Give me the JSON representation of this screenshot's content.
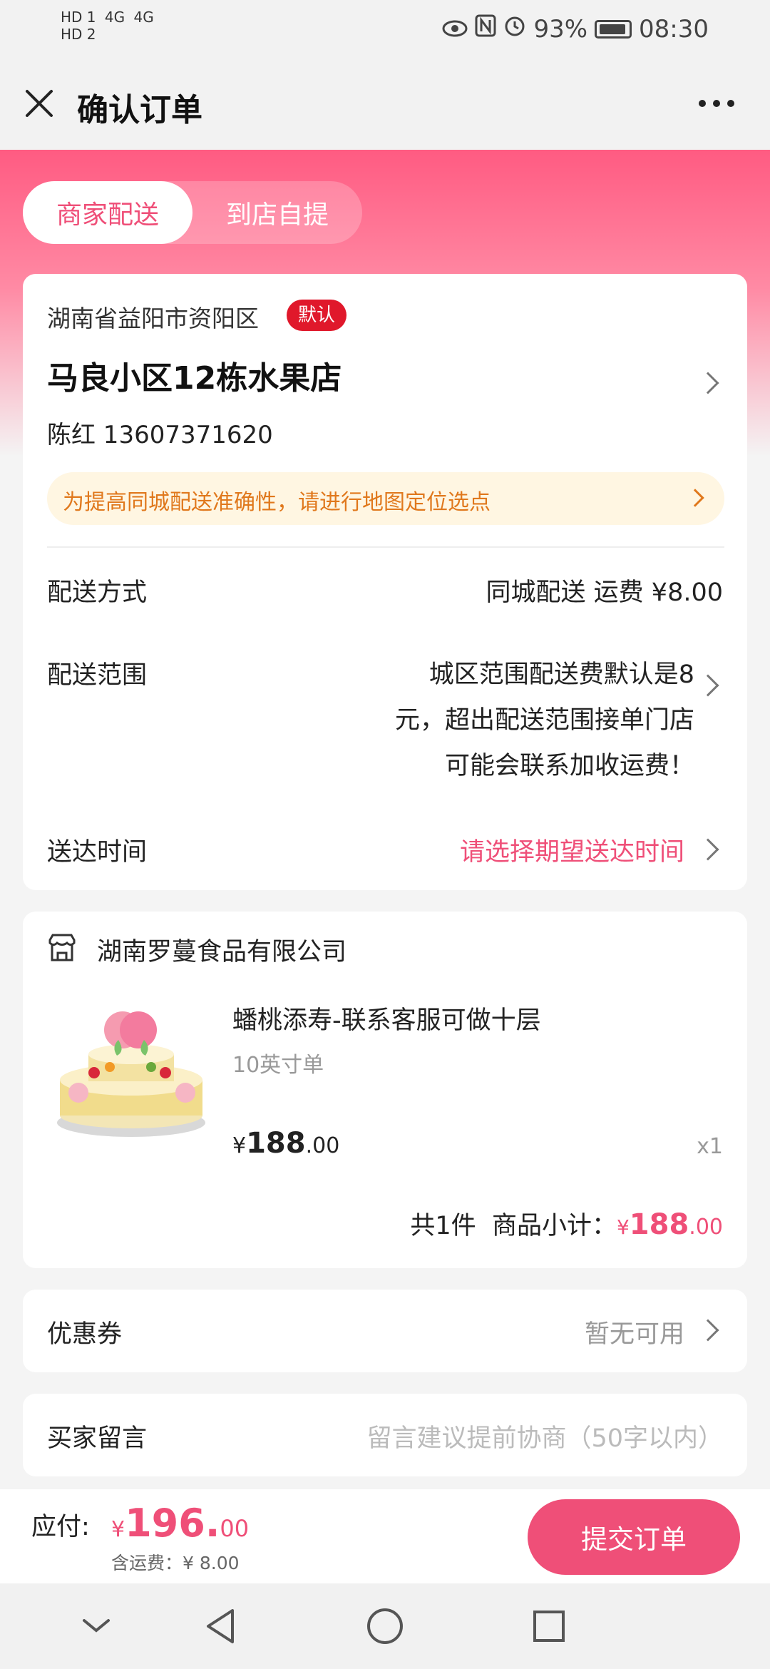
{
  "status_bar": {
    "hd1": "HD 1",
    "hd2": "HD 2",
    "signal1": "4G",
    "signal2": "4G",
    "battery": "93%",
    "time": "08:30"
  },
  "header": {
    "title": "确认订单"
  },
  "delivery_tabs": [
    {
      "label": "商家配送",
      "selected": true
    },
    {
      "label": "到店自提",
      "selected": false
    }
  ],
  "address": {
    "region": "湖南省益阳市资阳区",
    "default_badge": "默认",
    "name": "马良小区12栋水果店",
    "contact": "陈红 13607371620",
    "notice": "为提高同城配送准确性，请进行地图定位选点"
  },
  "delivery": {
    "method_label": "配送方式",
    "method_value": "同城配送 运费 ¥8.00",
    "range_label": "配送范围",
    "range_value": "城区范围配送费默认是8元，超出配送范围接单门店可能会联系加收运费！",
    "time_label": "送达时间",
    "time_value": "请选择期望送达时间"
  },
  "shop": {
    "name": "湖南罗蔓食品有限公司",
    "product": {
      "name": "蟠桃添寿-联系客服可做十层",
      "spec": "10英寸单",
      "price_currency": "¥",
      "price_int": "188",
      "price_dec": ".00",
      "qty": "x1"
    },
    "subtotal_count": "共1件",
    "subtotal_label": "商品小计：",
    "subtotal_currency": "¥",
    "subtotal_int": "188",
    "subtotal_dec": ".00"
  },
  "coupon": {
    "label": "优惠券",
    "value": "暂无可用"
  },
  "note": {
    "label": "买家留言",
    "placeholder": "留言建议提前协商（50字以内）"
  },
  "pay": {
    "label": "应付:",
    "currency": "¥",
    "amount_int": "196.",
    "amount_dec": "00",
    "shipping_note": "含运费：¥ 8.00",
    "submit_label": "提交订单"
  },
  "colors": {
    "accent": "#ef4f78",
    "badge": "#e0182b",
    "notice_text": "#e0781c",
    "notice_bg": "#fff6e2"
  }
}
